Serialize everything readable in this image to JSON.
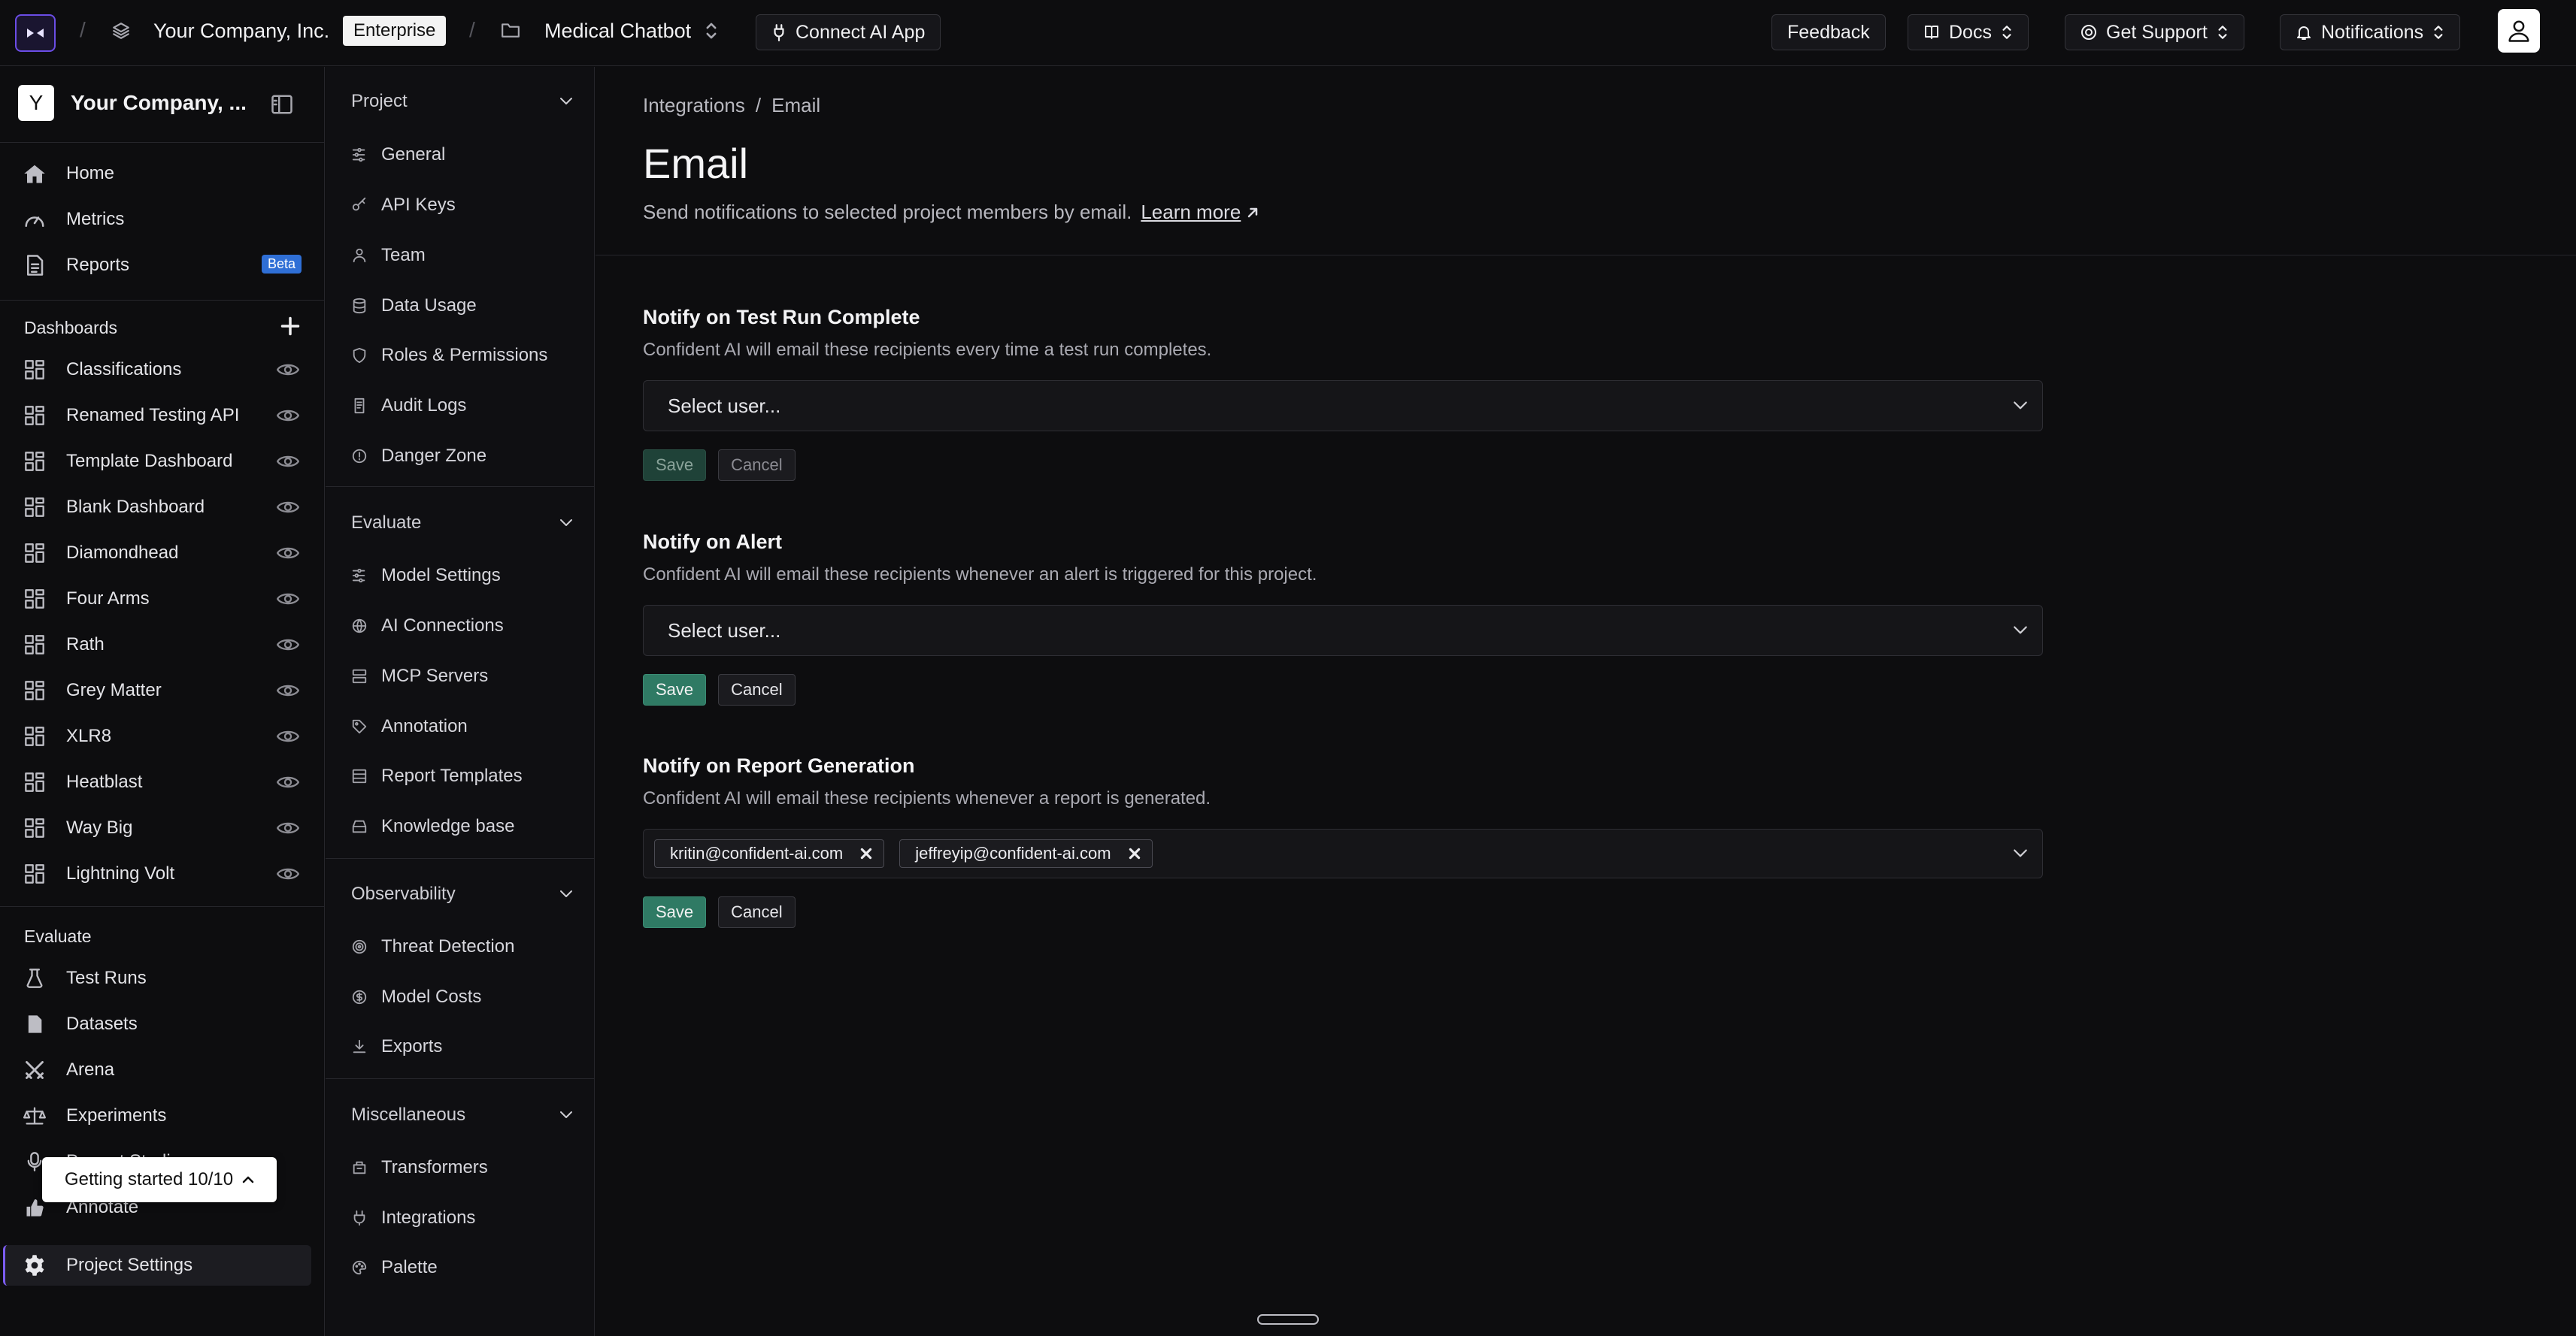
{
  "topbar": {
    "org_name": "Your Company, Inc.",
    "plan_badge": "Enterprise",
    "project_name": "Medical Chatbot",
    "connect_label": "Connect AI App",
    "feedback_label": "Feedback",
    "docs_label": "Docs",
    "support_label": "Get Support",
    "notifications_label": "Notifications"
  },
  "sidebar": {
    "company_initial": "Y",
    "company_name": "Your Company, ...",
    "main_items": [
      {
        "label": "Home",
        "icon": "home-icon"
      },
      {
        "label": "Metrics",
        "icon": "gauge-icon"
      },
      {
        "label": "Reports",
        "icon": "document-icon",
        "badge": "Beta"
      }
    ],
    "dashboards_heading": "Dashboards",
    "dashboards": [
      "Classifications",
      "Renamed Testing API",
      "Template Dashboard",
      "Blank Dashboard",
      "Diamondhead",
      "Four Arms",
      "Rath",
      "Grey Matter",
      "XLR8",
      "Heatblast",
      "Way Big",
      "Lightning Volt"
    ],
    "evaluate_heading": "Evaluate",
    "evaluate_items": [
      "Test Runs",
      "Datasets",
      "Arena",
      "Experiments",
      "Prompt Studio",
      "Annotate"
    ],
    "project_settings_label": "Project Settings",
    "getting_started_label": "Getting started 10/10"
  },
  "subnav": {
    "sections": [
      {
        "title": "Project",
        "items": [
          "General",
          "API Keys",
          "Team",
          "Data Usage",
          "Roles & Permissions",
          "Audit Logs",
          "Danger Zone"
        ]
      },
      {
        "title": "Evaluate",
        "items": [
          "Model Settings",
          "AI Connections",
          "MCP Servers",
          "Annotation",
          "Report Templates",
          "Knowledge base"
        ]
      },
      {
        "title": "Observability",
        "items": [
          "Threat Detection",
          "Model Costs",
          "Exports"
        ]
      },
      {
        "title": "Miscellaneous",
        "items": [
          "Transformers",
          "Integrations",
          "Palette"
        ]
      }
    ]
  },
  "main": {
    "breadcrumb": {
      "parent": "Integrations",
      "separator": "/",
      "current": "Email"
    },
    "title": "Email",
    "description": "Send notifications to selected project members by email.",
    "learn_more": "Learn more",
    "sections": [
      {
        "title": "Notify on Test Run Complete",
        "description": "Confident AI will email these recipients every time a test run completes.",
        "placeholder": "Select user...",
        "save": "Save",
        "cancel": "Cancel"
      },
      {
        "title": "Notify on Alert",
        "description": "Confident AI will email these recipients whenever an alert is triggered for this project.",
        "placeholder": "Select user...",
        "save": "Save",
        "cancel": "Cancel"
      },
      {
        "title": "Notify on Report Generation",
        "description": "Confident AI will email these recipients whenever a report is generated.",
        "tags": [
          "kritin@confident-ai.com",
          "jeffreyip@confident-ai.com"
        ],
        "save": "Save",
        "cancel": "Cancel"
      }
    ]
  },
  "colors": {
    "accent": "#6b4de6",
    "save_button": "#2f7a64",
    "beta_badge": "#2f6fd6",
    "background": "#0d0d0f"
  }
}
